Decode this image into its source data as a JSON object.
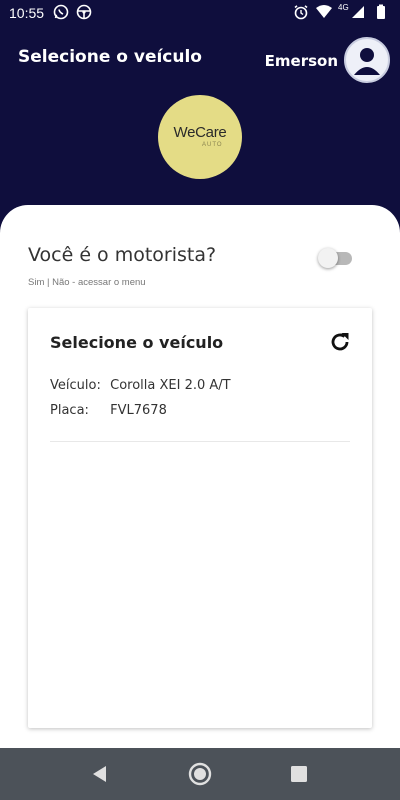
{
  "status_bar": {
    "time": "10:55",
    "network": "4G",
    "icons": [
      "whatsapp-icon",
      "steering-wheel-icon",
      "alarm-icon",
      "wifi-icon",
      "signal-icon",
      "battery-icon"
    ]
  },
  "header": {
    "title": "Selecione o veículo",
    "user_name": "Emerson",
    "logo_text": "WeCare",
    "logo_subtext": "AUTO"
  },
  "driver_question": {
    "label": "Você é o motorista?",
    "hint": "Sim | Não - acessar o menu",
    "toggle_on": false
  },
  "vehicle_card": {
    "title": "Selecione o veículo",
    "vehicle_label": "Veículo:",
    "vehicle_value": "Corolla XEI 2.0 A/T",
    "plate_label": "Placa:",
    "plate_value": "FVL7678"
  },
  "nav_bar": {
    "buttons": [
      "back-icon",
      "home-icon",
      "recents-icon"
    ]
  },
  "colors": {
    "header_bg": "#0f0e3d",
    "logo_bg": "#e4dc86",
    "nav_bg": "#4c5259"
  }
}
